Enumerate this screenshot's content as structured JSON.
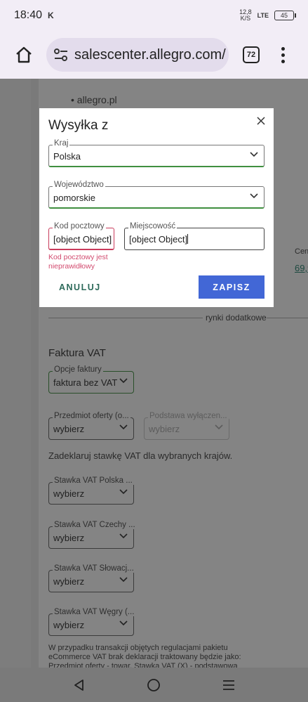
{
  "status_bar": {
    "time": "18:40",
    "notif_icon": "K",
    "speed_top": "12,8",
    "speed_bottom": "K/S",
    "network": "LTE",
    "battery": "45"
  },
  "browser": {
    "url": "salescenter.allegro.com/",
    "tab_count": "72"
  },
  "page": {
    "bullet": "allegro.pl",
    "cena_fragment": "Cen",
    "price_fragment": "69,9",
    "extra_markets": "rynki dodatkowe",
    "invoice_heading": "Faktura VAT",
    "invoice_options": {
      "label": "Opcje faktury",
      "value": "faktura bez VAT"
    },
    "offer_subject": {
      "label": "Przedmiot oferty (o...",
      "value": "wybierz"
    },
    "exemption_basis": {
      "label": "Podstawa wyłączen...",
      "value": "wybierz"
    },
    "declare_text": "Zadeklaruj stawkę VAT dla wybranych krajów.",
    "vat_pl": {
      "label": "Stawka VAT Polska ...",
      "value": "wybierz"
    },
    "vat_cz": {
      "label": "Stawka VAT Czechy ...",
      "value": "wybierz"
    },
    "vat_sk": {
      "label": "Stawka VAT Słowacj...",
      "value": "wybierz"
    },
    "vat_hu": {
      "label": "Stawka VAT Węgry (...",
      "value": "wybierz"
    },
    "footer_line1": "W przypadku transakcji objętych regulacjami pakietu",
    "footer_line2": "eCommerce VAT brak deklaracji traktowany będzie jako:",
    "footer_line3": "Przedmiot oferty - towar, Stawka VAT (X) - podstawowa"
  },
  "modal": {
    "title": "Wysyłka z",
    "country": {
      "label": "Kraj",
      "value": "Polska"
    },
    "voivodeship": {
      "label": "Województwo",
      "value": "pomorskie"
    },
    "postal_code": {
      "label": "Kod pocztowy",
      "value": "[object Object]",
      "error": "Kod pocztowy jest nieprawidłowy"
    },
    "city": {
      "label": "Miejscowość",
      "value": "[object Object]"
    },
    "cancel_label": "ANULUJ",
    "save_label": "ZAPISZ"
  },
  "colors": {
    "primary": "#4267d6",
    "error": "#d24a6e",
    "success": "#3f8f3f",
    "cancel": "#2d6a5a"
  }
}
